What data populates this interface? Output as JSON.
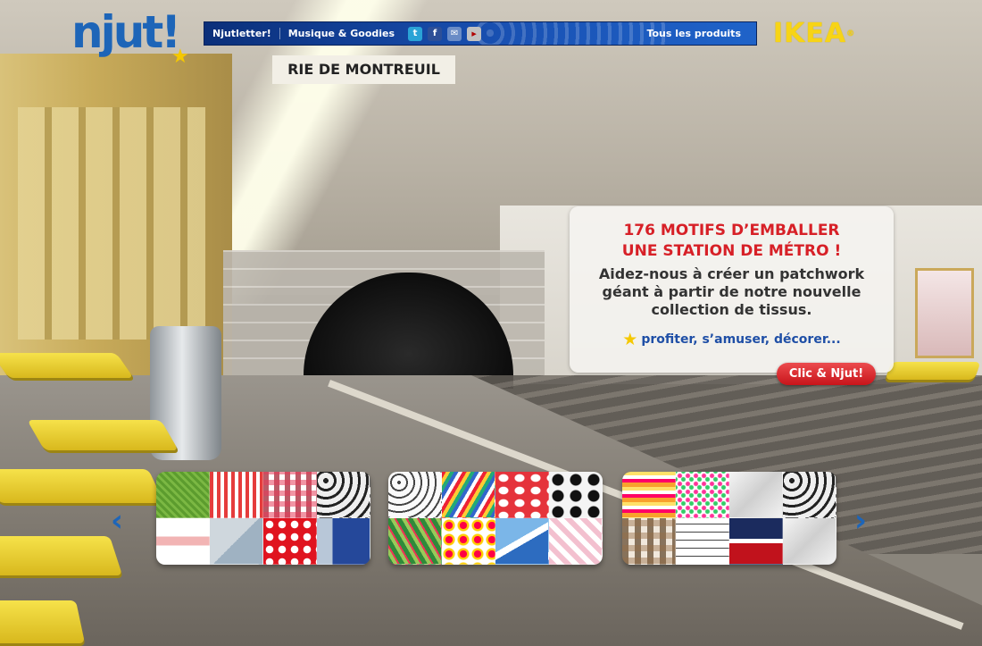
{
  "background": {
    "station_sign": "MAIRIE DE MONTREUIL",
    "station_sign_visible": "RIE DE MONTREUIL"
  },
  "header": {
    "logo": "njut!",
    "nav": {
      "newsletter_label": "Njutletter!",
      "music_label": "Musique & Goodies",
      "social_icons": [
        "twitter-icon",
        "facebook-icon",
        "email-icon",
        "youtube-icon"
      ],
      "all_products_label": "Tous les produits"
    },
    "brand": "IKEA",
    "brand_mark": "®"
  },
  "promo": {
    "title_line1": "176 MOTIFS D’EMBALLER",
    "title_line2": "UNE STATION DE MÉTRO !",
    "body_line1": "Aidez-nous à créer un patchwork",
    "body_line2": "géant à partir de notre nouvelle",
    "body_line3": "collection de tissus.",
    "link": "profiter, s’amuser, décorer...",
    "cta_label": "Clic & Njut!"
  },
  "carousel": {
    "prev_arrow": "‹",
    "next_arrow": "›",
    "items": [
      "patchwork-parcel-1",
      "patchwork-parcel-2",
      "patchwork-parcel-3"
    ]
  },
  "colors": {
    "brand_blue": "#1d65b8",
    "promo_red": "#d72027",
    "ikea_yellow": "#f7d416",
    "cta_red": "#c8141a"
  }
}
